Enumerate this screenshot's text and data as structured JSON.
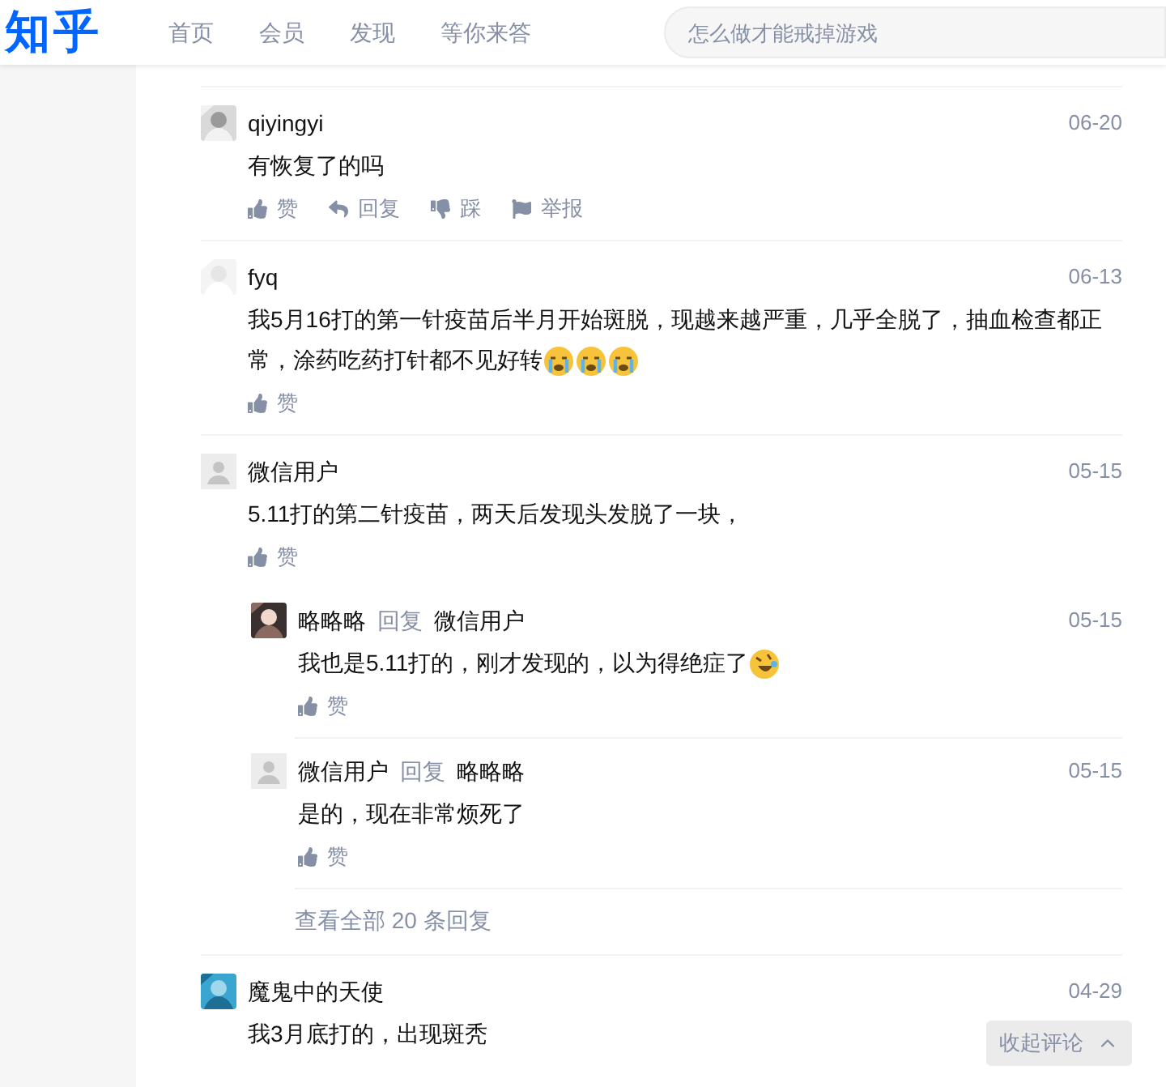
{
  "header": {
    "logo": "知乎",
    "nav": [
      {
        "label": "首页"
      },
      {
        "label": "会员"
      },
      {
        "label": "发现"
      },
      {
        "label": "等你来答"
      }
    ],
    "search": {
      "placeholder": "怎么做才能戒掉游戏"
    }
  },
  "comments": [
    {
      "author": "qiyingyi",
      "avatar": {
        "kind": "picture"
      },
      "date": "06-20",
      "text": "有恢复了的吗",
      "actions": [
        {
          "kind": "like",
          "label": "赞"
        },
        {
          "kind": "reply",
          "label": "回复"
        },
        {
          "kind": "dislike",
          "label": "踩"
        },
        {
          "kind": "report",
          "label": "举报"
        }
      ]
    },
    {
      "author": "fyq",
      "avatar": {
        "kind": "picture"
      },
      "date": "06-13",
      "text": "我5月16打的第一针疫苗后半月开始斑脱，现越来越严重，几乎全脱了，抽血检查都正常，涂药吃药打针都不见好转",
      "emojis": [
        {
          "kind": "crying"
        },
        {
          "kind": "crying"
        },
        {
          "kind": "crying"
        }
      ],
      "actions": [
        {
          "kind": "like",
          "label": "赞"
        }
      ]
    },
    {
      "author": "微信用户",
      "avatar": {
        "kind": "default"
      },
      "date": "05-15",
      "text": "5.11打的第二针疫苗，两天后发现头发脱了一块，",
      "actions": [
        {
          "kind": "like",
          "label": "赞"
        }
      ],
      "replies": [
        {
          "author": "略略略",
          "avatar": {
            "kind": "picture"
          },
          "reply_word": "回复",
          "reply_to": "微信用户",
          "date": "05-15",
          "text": "我也是5.11打的，刚才发现的，以为得绝症了",
          "emojis": [
            {
              "kind": "laughing"
            }
          ],
          "actions": [
            {
              "kind": "like",
              "label": "赞"
            }
          ]
        },
        {
          "author": "微信用户",
          "avatar": {
            "kind": "default"
          },
          "reply_word": "回复",
          "reply_to": "略略略",
          "date": "05-15",
          "text": "是的，现在非常烦死了",
          "actions": [
            {
              "kind": "like",
              "label": "赞"
            }
          ]
        }
      ],
      "more_replies": "查看全部 20 条回复"
    },
    {
      "author": "魔鬼中的天使",
      "avatar": {
        "kind": "picture"
      },
      "date": "04-29",
      "text": "我3月底打的，出现斑秃"
    }
  ],
  "collapse_button": {
    "label": "收起评论"
  }
}
